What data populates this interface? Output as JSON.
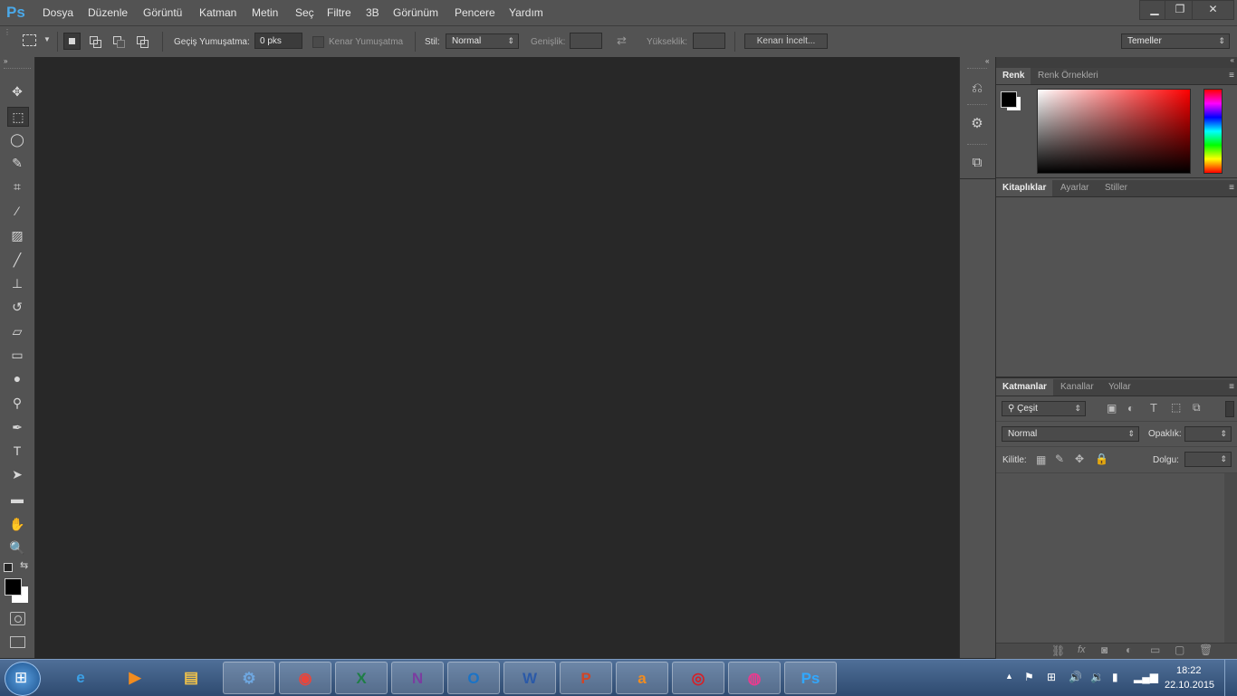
{
  "app": {
    "logo_text": "Ps",
    "menu": [
      "Dosya",
      "Düzenle",
      "Görüntü",
      "Katman",
      "Metin",
      "Seç",
      "Filtre",
      "3B",
      "Görünüm",
      "Pencere",
      "Yardım"
    ],
    "window_controls": {
      "minimize": "▁",
      "restore": "❐",
      "close": "✕"
    }
  },
  "options_bar": {
    "feather_label": "Geçiş Yumuşatma:",
    "feather_value": "0 pks",
    "antialias_label": "Kenar Yumuşatma",
    "style_label": "Stil:",
    "style_value": "Normal",
    "width_label": "Genişlik:",
    "height_label": "Yükseklik:",
    "refine_edge_label": "Kenarı İncelt...",
    "workspace_value": "Temeller"
  },
  "tools": [
    {
      "icon": "move-icon",
      "glyph": "✥"
    },
    {
      "icon": "marquee-icon",
      "glyph": "⬚"
    },
    {
      "icon": "lasso-icon",
      "glyph": "◯"
    },
    {
      "icon": "quick-select-icon",
      "glyph": "✎"
    },
    {
      "icon": "crop-icon",
      "glyph": "⌗"
    },
    {
      "icon": "eyedropper-icon",
      "glyph": "⁄"
    },
    {
      "icon": "healing-brush-icon",
      "glyph": "▨"
    },
    {
      "icon": "brush-icon",
      "glyph": "╱"
    },
    {
      "icon": "clone-stamp-icon",
      "glyph": "⊥"
    },
    {
      "icon": "history-brush-icon",
      "glyph": "↺"
    },
    {
      "icon": "eraser-icon",
      "glyph": "▱"
    },
    {
      "icon": "gradient-icon",
      "glyph": "▭"
    },
    {
      "icon": "blur-icon",
      "glyph": "●"
    },
    {
      "icon": "dodge-icon",
      "glyph": "⚲"
    },
    {
      "icon": "pen-icon",
      "glyph": "✒"
    },
    {
      "icon": "type-icon",
      "glyph": "T"
    },
    {
      "icon": "path-select-icon",
      "glyph": "➤"
    },
    {
      "icon": "rectangle-shape-icon",
      "glyph": "▬"
    },
    {
      "icon": "hand-icon",
      "glyph": "✋"
    },
    {
      "icon": "zoom-icon",
      "glyph": "🔍"
    }
  ],
  "panels": {
    "color_tabs": [
      "Renk",
      "Renk Örnekleri"
    ],
    "library_tabs": [
      "Kitaplıklar",
      "Ayarlar",
      "Stiller"
    ],
    "layer_tabs": [
      "Katmanlar",
      "Kanallar",
      "Yollar"
    ],
    "filter_kind": "Çeşit",
    "blend_mode": "Normal",
    "opacity_label": "Opaklık:",
    "lock_label": "Kilitle:",
    "fill_label": "Dolgu:"
  },
  "taskbar": {
    "apps": [
      {
        "name": "explorer-ie",
        "glyph": "e",
        "color": "#3ba0e6"
      },
      {
        "name": "media-player",
        "glyph": "▶",
        "color": "#f28c1f"
      },
      {
        "name": "file-explorer",
        "glyph": "▤",
        "color": "#f1c24a"
      },
      {
        "name": "tool-app",
        "glyph": "⚙",
        "color": "#6ea7e0"
      },
      {
        "name": "chrome",
        "glyph": "◉",
        "color": "#e8453c"
      },
      {
        "name": "excel",
        "glyph": "X",
        "color": "#1e7e45"
      },
      {
        "name": "onenote",
        "glyph": "N",
        "color": "#7b3ea0"
      },
      {
        "name": "outlook",
        "glyph": "O",
        "color": "#1a73c6"
      },
      {
        "name": "word",
        "glyph": "W",
        "color": "#2b5aa8"
      },
      {
        "name": "powerpoint",
        "glyph": "P",
        "color": "#d04526"
      },
      {
        "name": "avast",
        "glyph": "a",
        "color": "#f28c1f"
      },
      {
        "name": "creative-cloud",
        "glyph": "◎",
        "color": "#d52128"
      },
      {
        "name": "uplay",
        "glyph": "◍",
        "color": "#e93b8e"
      },
      {
        "name": "photoshop",
        "glyph": "Ps",
        "color": "#31a8ff"
      }
    ],
    "time": "18:22",
    "date": "22.10.2015"
  }
}
